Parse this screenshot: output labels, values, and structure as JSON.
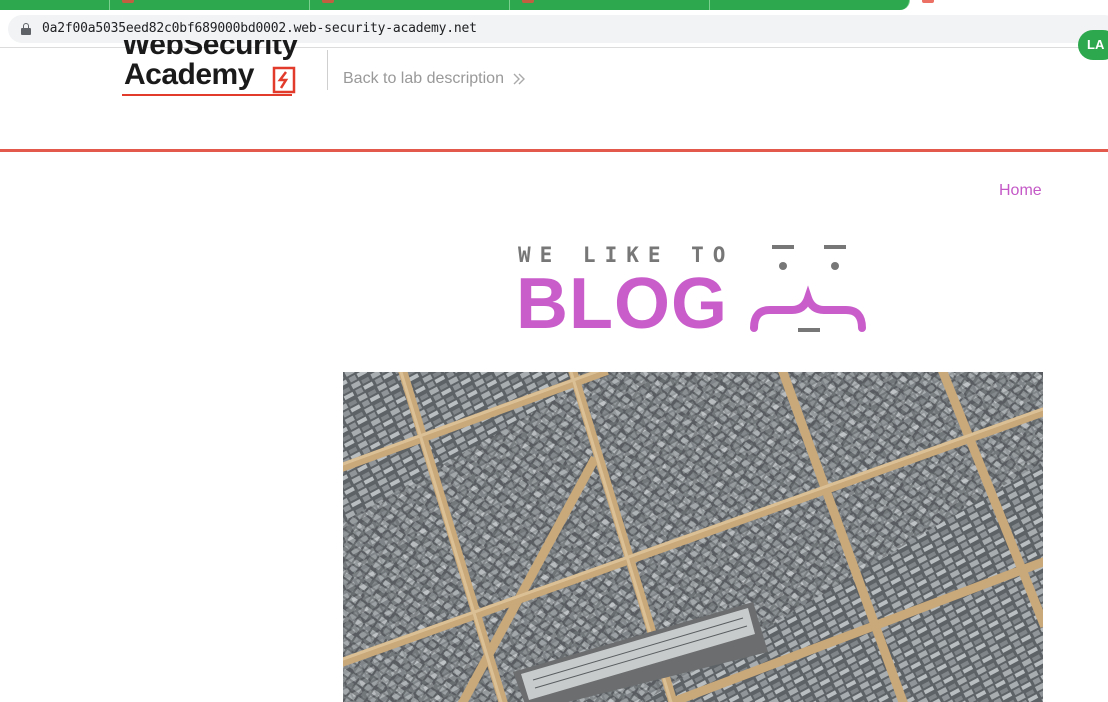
{
  "browser": {
    "url": "0a2f00a5035eed82c0bf689000bd0002.web-security-academy.net",
    "tab_color": "#2ea84f"
  },
  "header": {
    "logo_line1": "WebSecurity",
    "logo_line2": "Academy",
    "back_link": "Back to lab description",
    "status_badge": "LA"
  },
  "nav": {
    "home": "Home"
  },
  "banner": {
    "tagline": "WE LIKE TO",
    "title": "BLOG"
  },
  "hero": {
    "image": "letterpress-type-tray-photo"
  },
  "colors": {
    "accent": "#c459c7",
    "rule": "#e3594b",
    "brand_red": "#e23b2b"
  }
}
